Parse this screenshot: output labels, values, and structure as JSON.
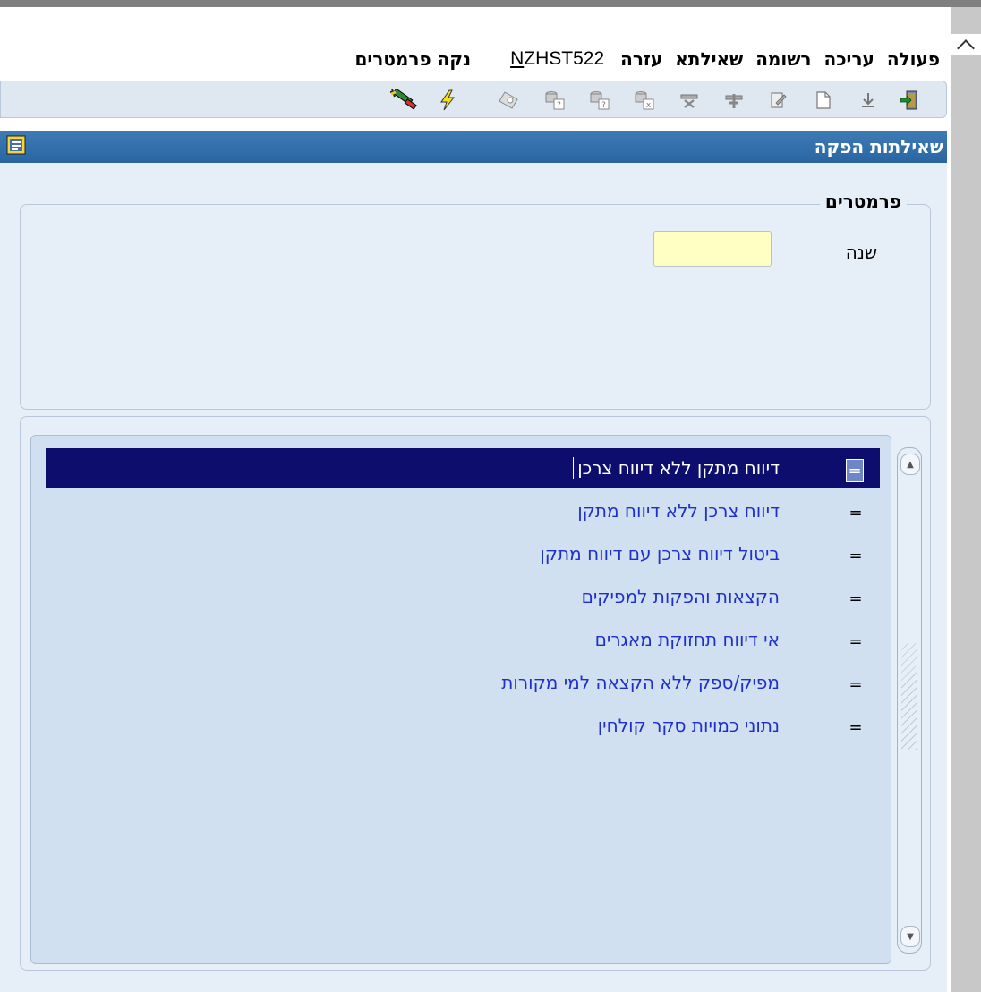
{
  "menu": {
    "items": [
      "פעולה",
      "עריכה",
      "רשומה",
      "שאילתא",
      "עזרה"
    ],
    "form_id_first": "N",
    "form_id_rest": "ZHST522",
    "clear_params": "נקה פרמטרים"
  },
  "toolbar": {
    "icons": [
      "exit-icon",
      "download-icon",
      "new-document-icon",
      "edit-record-icon",
      "insert-record-icon",
      "delete-record-icon",
      "query-db-icon",
      "query-db-icon-2",
      "query-db-icon-3",
      "save-disk-icon",
      "lightning-icon",
      "magic-wand-icon"
    ]
  },
  "window": {
    "title": "שאילתות הפקה"
  },
  "params": {
    "legend": "פרמטרים",
    "year_label": "שנה",
    "year_value": ""
  },
  "list": {
    "marker": "=",
    "items": [
      "דיווח מתקן ללא דיווח צרכן",
      "דיווח צרכן ללא דיווח מתקן",
      "ביטול דיווח צרכן עם דיווח מתקן",
      "הקצאות והפקות למפיקים",
      "אי דיווח תחזוקת מאגרים",
      "מפיק/ספק ללא הקצאה למי מקורות",
      "נתוני כמויות סקר קולחין"
    ],
    "selected_index": 0
  },
  "colors": {
    "selection": "#0d0d6e",
    "link_text": "#1e2fcc",
    "title_bar": "#2f6ca8",
    "input_bg": "#ffffc4"
  }
}
